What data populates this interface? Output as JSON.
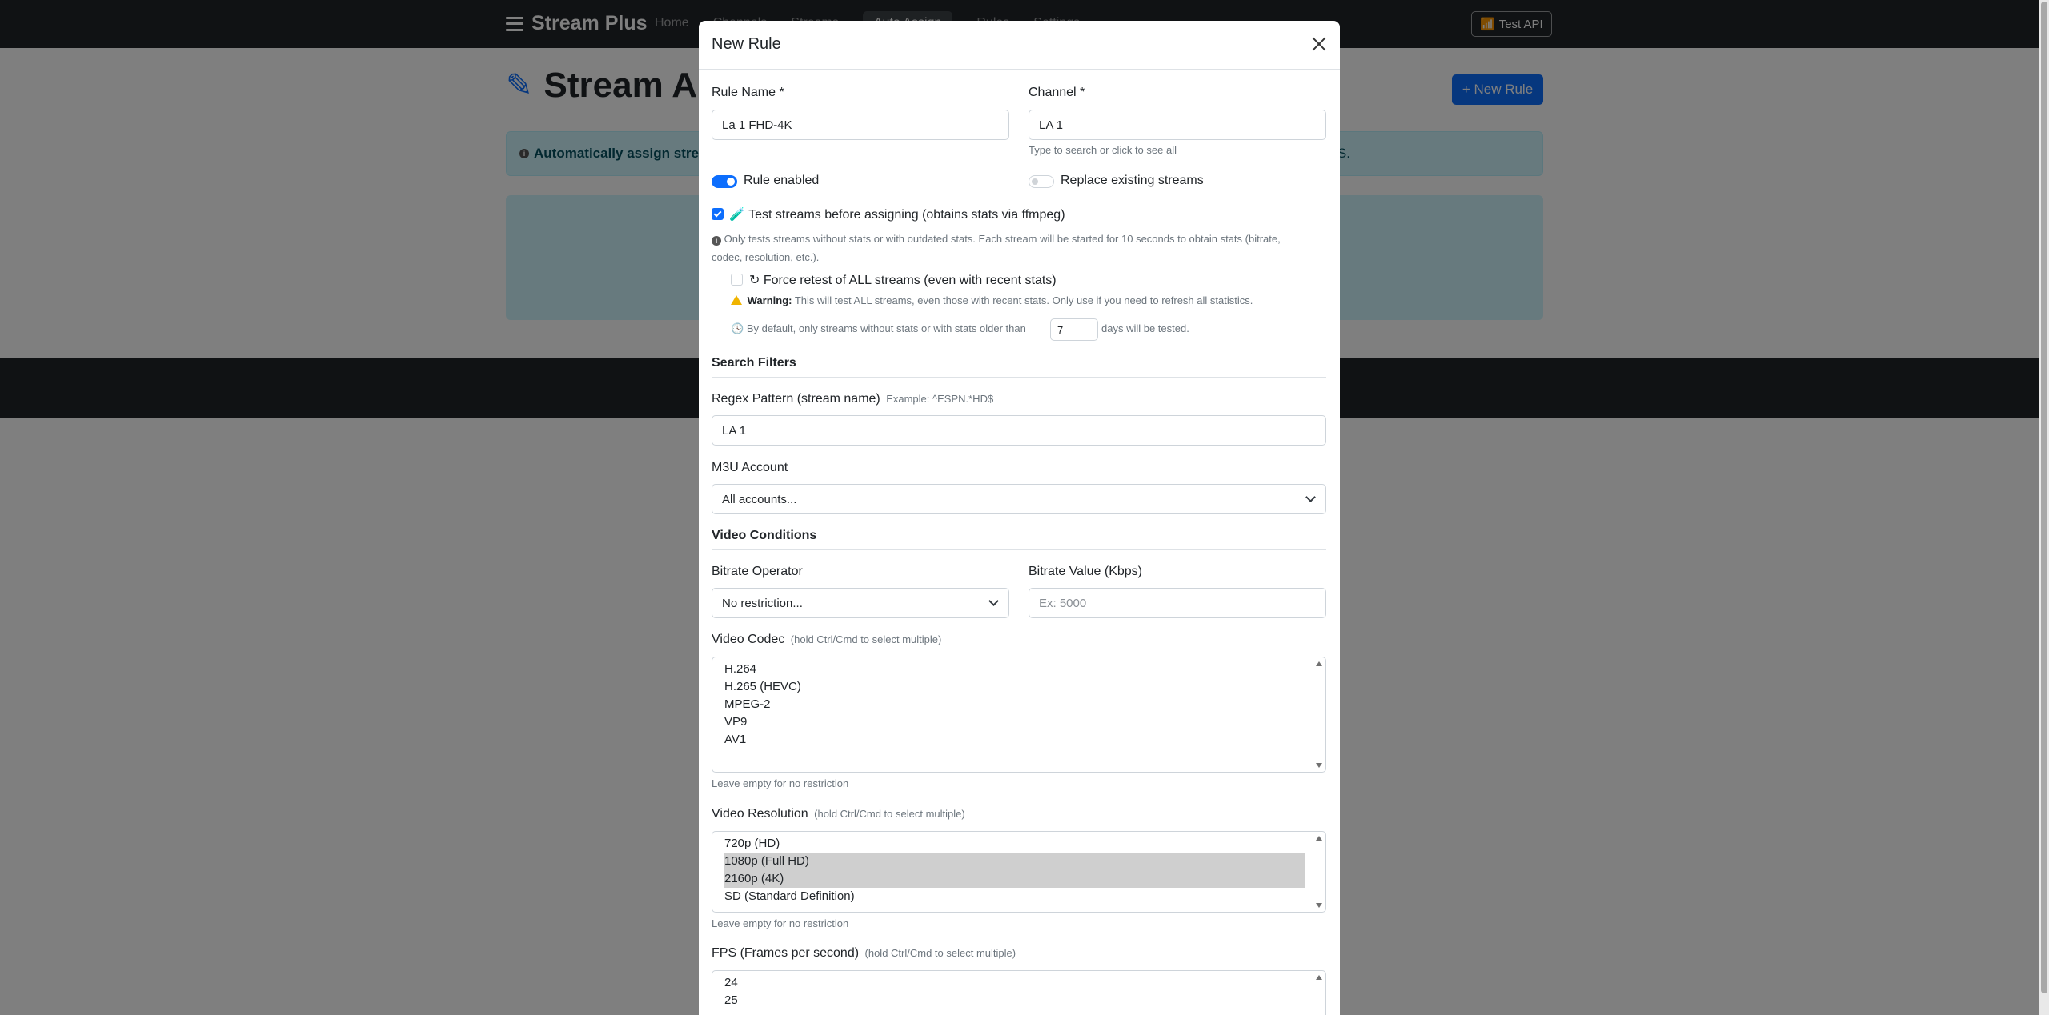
{
  "navbar": {
    "brand": "Stream Plus",
    "links": [
      "Home",
      "Channels",
      "Streams",
      "Auto Assign",
      "Rules",
      "Settings"
    ],
    "test_api": "Test API"
  },
  "page": {
    "title": "Stream Au",
    "new_rule_button": "+ New Rule",
    "alert_text": "Automatically assign strean",
    "alert_tail": "PS."
  },
  "modal": {
    "title": "New Rule",
    "rule_name": {
      "label": "Rule Name *",
      "value": "La 1 FHD-4K"
    },
    "channel": {
      "label": "Channel *",
      "value": "LA 1",
      "help": "Type to search or click to see all"
    },
    "rule_enabled": {
      "label": "Rule enabled",
      "on": true
    },
    "replace_streams": {
      "label": "Replace existing streams",
      "on": false
    },
    "test_streams": {
      "label": "🧪 Test streams before assigning (obtains stats via ffmpeg)",
      "checked": true,
      "info_line1": "Only tests streams without stats or with outdated stats. Each stream will be started for 10 seconds to obtain stats (bitrate,",
      "info_line2": "codec, resolution, etc.)."
    },
    "force_retest": {
      "label": "Force retest of ALL streams (even with recent stats)",
      "checked": false,
      "warning_bold": "Warning:",
      "warning_text": "This will test ALL streams, even those with recent stats. Only use if you need to refresh all statistics.",
      "days_prefix": "By default, only streams without stats or with stats older than",
      "days_value": "7",
      "days_suffix": "days will be tested."
    },
    "search_filters": {
      "title": "Search Filters",
      "regex_label": "Regex Pattern (stream name)",
      "regex_hint": "Example: ^ESPN.*HD$",
      "regex_value": "LA 1",
      "m3u_label": "M3U Account",
      "m3u_value": "All accounts..."
    },
    "video_conditions": {
      "title": "Video Conditions",
      "bitrate_operator_label": "Bitrate Operator",
      "bitrate_operator_value": "No restriction...",
      "bitrate_value_label": "Bitrate Value (Kbps)",
      "bitrate_value_placeholder": "Ex: 5000",
      "codec_label": "Video Codec",
      "codec_hint": "(hold Ctrl/Cmd to select multiple)",
      "codec_options": [
        {
          "label": "H.264",
          "selected": false
        },
        {
          "label": "H.265 (HEVC)",
          "selected": false
        },
        {
          "label": "MPEG-2",
          "selected": false
        },
        {
          "label": "VP9",
          "selected": false
        },
        {
          "label": "AV1",
          "selected": false
        }
      ],
      "codec_help": "Leave empty for no restriction",
      "resolution_label": "Video Resolution",
      "resolution_hint": "(hold Ctrl/Cmd to select multiple)",
      "resolution_options": [
        {
          "label": "720p (HD)",
          "selected": false
        },
        {
          "label": "1080p (Full HD)",
          "selected": true
        },
        {
          "label": "2160p (4K)",
          "selected": true
        },
        {
          "label": "SD (Standard Definition)",
          "selected": false
        }
      ],
      "resolution_help": "Leave empty for no restriction",
      "fps_label": "FPS (Frames per second)",
      "fps_hint": "(hold Ctrl/Cmd to select multiple)",
      "fps_options": [
        {
          "label": "24",
          "selected": false
        },
        {
          "label": "25",
          "selected": false
        }
      ]
    }
  }
}
